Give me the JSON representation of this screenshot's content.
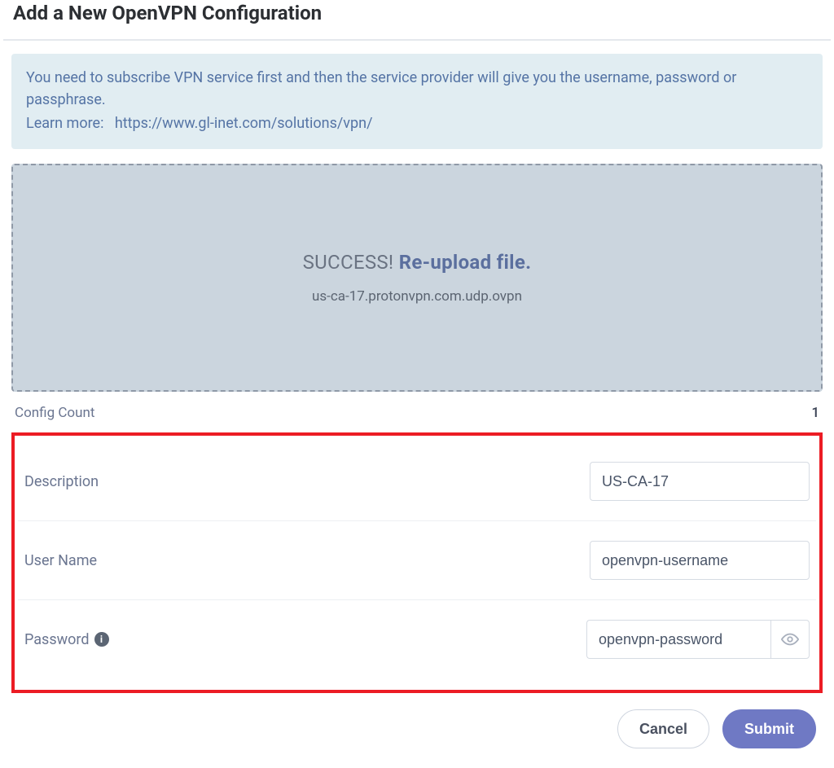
{
  "title": "Add a New OpenVPN Configuration",
  "info": {
    "text": "You need to subscribe VPN service first and then the service provider will give you the username, password or passphrase.",
    "learn_label": "Learn more:",
    "learn_url_text": "https://www.gl-inet.com/solutions/vpn/"
  },
  "dropzone": {
    "status_prefix": "SUCCESS!",
    "action_text": "Re-upload file.",
    "filename": "us-ca-17.protonvpn.com.udp.ovpn"
  },
  "config_count": {
    "label": "Config Count",
    "value": "1"
  },
  "form": {
    "description": {
      "label": "Description",
      "value": "US-CA-17"
    },
    "username": {
      "label": "User Name",
      "value": "openvpn-username"
    },
    "password": {
      "label": "Password",
      "value": "openvpn-password"
    }
  },
  "footer": {
    "cancel": "Cancel",
    "submit": "Submit"
  }
}
